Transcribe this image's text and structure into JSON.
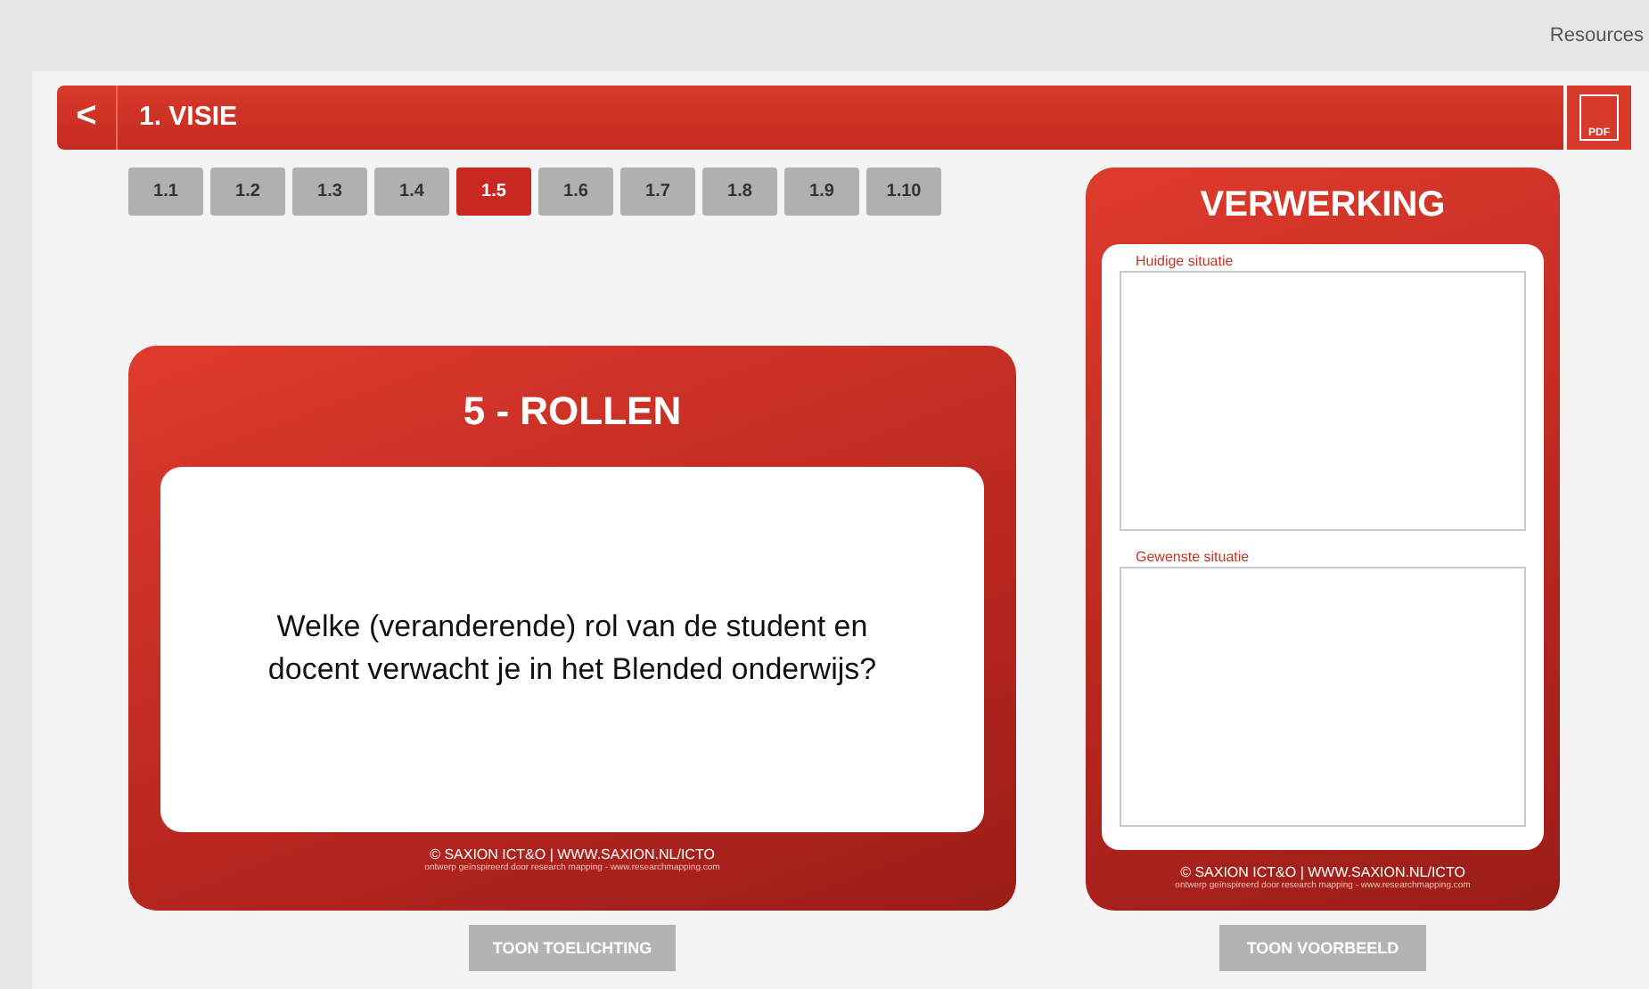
{
  "top_bar": {
    "link": "Resources"
  },
  "header": {
    "back": "<",
    "title": "1. VISIE",
    "pdf": "PDF"
  },
  "tabs": [
    {
      "label": "1.1",
      "selected": false
    },
    {
      "label": "1.2",
      "selected": false
    },
    {
      "label": "1.3",
      "selected": false
    },
    {
      "label": "1.4",
      "selected": false
    },
    {
      "label": "1.5",
      "selected": true
    },
    {
      "label": "1.6",
      "selected": false
    },
    {
      "label": "1.7",
      "selected": false
    },
    {
      "label": "1.8",
      "selected": false
    },
    {
      "label": "1.9",
      "selected": false
    },
    {
      "label": "1.10",
      "selected": false
    }
  ],
  "question_card": {
    "title": "5 - ROLLEN",
    "question": "Welke (veranderende) rol van de student en docent verwacht je in het Blended onderwijs?",
    "credit": "© SAXION ICT&O | WWW.SAXION.NL/ICTO",
    "subcredit": "ontwerp geïnspireerd door research mapping - www.researchmapping.com",
    "button": "TOON TOELICHTING"
  },
  "work_card": {
    "title": "VERWERKING",
    "fields": [
      {
        "label": "Huidige situatie"
      },
      {
        "label": "Gewenste situatie"
      }
    ],
    "credit": "© SAXION ICT&O | WWW.SAXION.NL/ICTO",
    "subcredit": "ontwerp geïnspireerd door research mapping - www.researchmapping.com",
    "button": "TOON VOORBEELD"
  }
}
